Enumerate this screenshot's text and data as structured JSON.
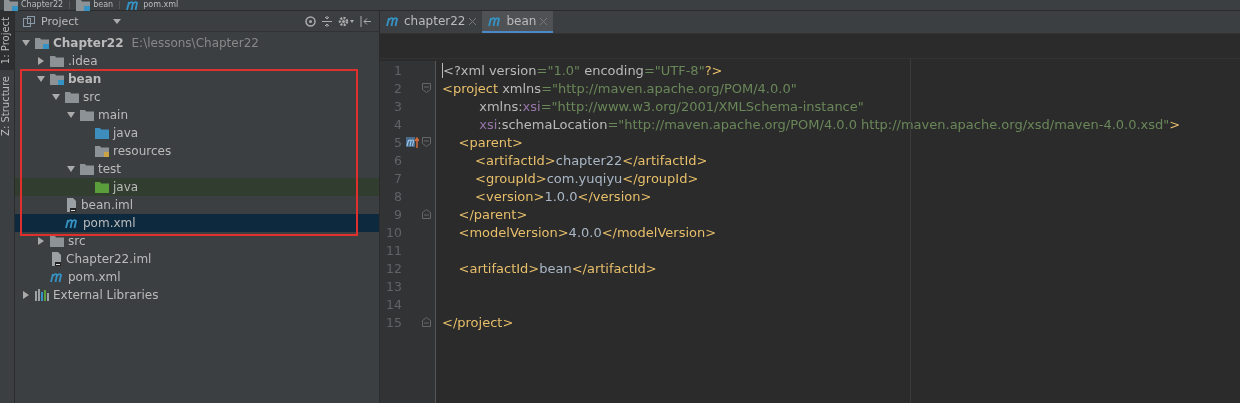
{
  "breadcrumbs": [
    {
      "label": "Chapter22",
      "kind": "module"
    },
    {
      "label": "bean",
      "kind": "module"
    },
    {
      "label": "pom.xml",
      "kind": "maven"
    }
  ],
  "tool_strip": [
    {
      "label": "1: Project",
      "selected": true
    },
    {
      "label": "Z: Structure",
      "selected": false
    }
  ],
  "project_panel": {
    "title": "Project",
    "tree": [
      {
        "label": "Chapter22",
        "path": "E:\\lessons\\Chapter22",
        "kind": "module",
        "expanded": true,
        "selected": false,
        "children": [
          {
            "label": ".idea",
            "kind": "folder",
            "expanded": false,
            "selected": false
          },
          {
            "label": "bean",
            "kind": "module",
            "expanded": true,
            "selected": false,
            "children": [
              {
                "label": "src",
                "kind": "folder",
                "expanded": true,
                "selected": false,
                "children": [
                  {
                    "label": "main",
                    "kind": "folder",
                    "expanded": true,
                    "selected": false,
                    "children": [
                      {
                        "label": "java",
                        "kind": "source",
                        "selected": false
                      },
                      {
                        "label": "resources",
                        "kind": "resources",
                        "selected": false
                      }
                    ]
                  },
                  {
                    "label": "test",
                    "kind": "folder",
                    "expanded": true,
                    "selected": false,
                    "children": [
                      {
                        "label": "java",
                        "kind": "test",
                        "selected": false
                      }
                    ]
                  }
                ]
              },
              {
                "label": "bean.iml",
                "kind": "iml",
                "selected": false
              },
              {
                "label": "pom.xml",
                "kind": "maven",
                "selected": true
              }
            ]
          },
          {
            "label": "src",
            "kind": "folder",
            "expanded": false,
            "selected": false
          },
          {
            "label": "Chapter22.iml",
            "kind": "iml",
            "selected": false
          },
          {
            "label": "pom.xml",
            "kind": "maven",
            "selected": false
          }
        ]
      },
      {
        "label": "External Libraries",
        "kind": "libraries",
        "expanded": false,
        "selected": false
      }
    ]
  },
  "editor": {
    "tabs": [
      {
        "label": "chapter22",
        "selected": false
      },
      {
        "label": "bean",
        "selected": true
      }
    ],
    "lines": [
      {
        "number": "1",
        "kind": "plain",
        "override": false,
        "tokens": [
          {
            "text": "<?xml version",
            "kind": "attr"
          },
          {
            "text": "=\"1.0\"",
            "kind": "value"
          },
          {
            "text": " encoding",
            "kind": "attr"
          },
          {
            "text": "=\"UTF-8\"",
            "kind": "value"
          },
          {
            "text": "?>",
            "kind": "tag"
          }
        ]
      },
      {
        "number": "2",
        "kind": "fold_start",
        "override": false,
        "tokens": [
          {
            "text": "<project",
            "kind": "tag"
          },
          {
            "text": " xmlns",
            "kind": "attr"
          },
          {
            "text": "=\"http://maven.apache.org/POM/4.0.0\"",
            "kind": "value"
          }
        ]
      },
      {
        "number": "3",
        "kind": "plain",
        "override": false,
        "tokens": [
          {
            "text": "         xmlns:",
            "kind": "attr"
          },
          {
            "text": "xsi",
            "kind": "ns"
          },
          {
            "text": "=\"http://www.w3.org/2001/XMLSchema-instance\"",
            "kind": "value"
          }
        ]
      },
      {
        "number": "4",
        "kind": "plain",
        "override": false,
        "tokens": [
          {
            "text": "         xsi",
            "kind": "ns"
          },
          {
            "text": ":schemaLocation",
            "kind": "attr"
          },
          {
            "text": "=\"http://maven.apache.org/POM/4.0.0 http://maven.apache.org/xsd/maven-4.0.0.xsd\"",
            "kind": "value"
          },
          {
            "text": ">",
            "kind": "tag"
          }
        ]
      },
      {
        "number": "5",
        "kind": "fold_start",
        "override": true,
        "tokens": [
          {
            "text": "    <parent>",
            "kind": "tag"
          }
        ]
      },
      {
        "number": "6",
        "kind": "plain",
        "override": false,
        "tokens": [
          {
            "text": "        <artifactId>",
            "kind": "tag"
          },
          {
            "text": "chapter22",
            "kind": "text"
          },
          {
            "text": "</artifactId>",
            "kind": "tag"
          }
        ]
      },
      {
        "number": "7",
        "kind": "plain",
        "override": false,
        "tokens": [
          {
            "text": "        <groupId>",
            "kind": "tag"
          },
          {
            "text": "com.yuqiyu",
            "kind": "text"
          },
          {
            "text": "</groupId>",
            "kind": "tag"
          }
        ]
      },
      {
        "number": "8",
        "kind": "plain",
        "override": false,
        "tokens": [
          {
            "text": "        <version>",
            "kind": "tag"
          },
          {
            "text": "1.0.0",
            "kind": "text"
          },
          {
            "text": "</version>",
            "kind": "tag"
          }
        ]
      },
      {
        "number": "9",
        "kind": "fold_end",
        "override": false,
        "tokens": [
          {
            "text": "    </parent>",
            "kind": "tag"
          }
        ]
      },
      {
        "number": "10",
        "kind": "plain",
        "override": false,
        "tokens": [
          {
            "text": "    <modelVersion>",
            "kind": "tag"
          },
          {
            "text": "4.0.0",
            "kind": "text"
          },
          {
            "text": "</modelVersion>",
            "kind": "tag"
          }
        ]
      },
      {
        "number": "11",
        "kind": "plain",
        "override": false
      },
      {
        "number": "12",
        "kind": "plain",
        "override": false,
        "tokens": [
          {
            "text": "    <artifactId>",
            "kind": "tag"
          },
          {
            "text": "bean",
            "kind": "text"
          },
          {
            "text": "</artifactId>",
            "kind": "tag"
          }
        ]
      },
      {
        "number": "13",
        "kind": "plain",
        "override": false
      },
      {
        "number": "14",
        "kind": "plain",
        "override": false
      },
      {
        "number": "15",
        "kind": "fold_end",
        "override": false,
        "tokens": [
          {
            "text": "</project>",
            "kind": "tag"
          }
        ]
      }
    ]
  }
}
